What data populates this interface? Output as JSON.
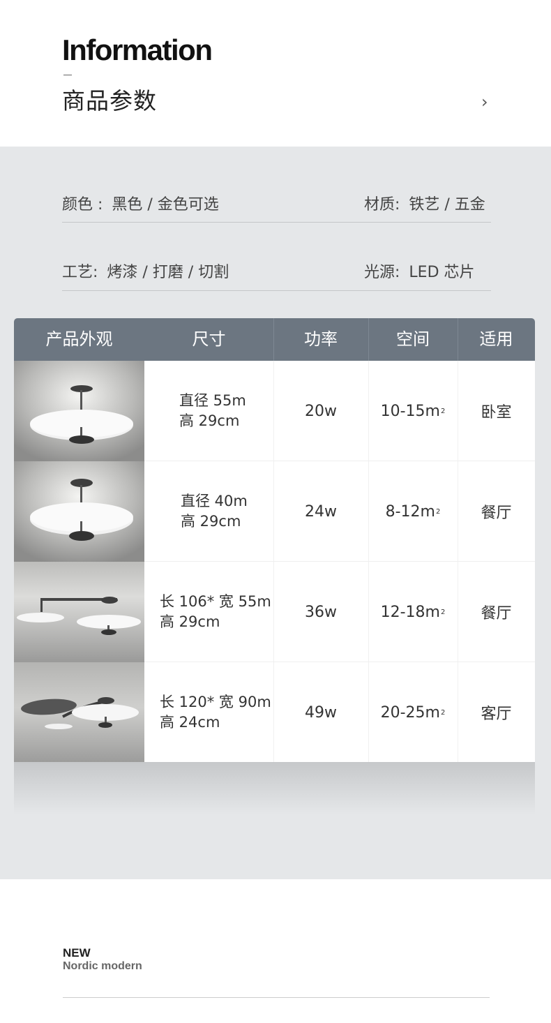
{
  "header": {
    "title_en": "Information",
    "title_cn": "商品参数"
  },
  "specs": [
    {
      "label": "颜色 : ",
      "value": "黑色 / 金色可选"
    },
    {
      "label": "材质: ",
      "value": "铁艺 / 五金"
    },
    {
      "label": "工艺: ",
      "value": "烤漆 / 打磨 / 切割"
    },
    {
      "label": "光源: ",
      "value": "LED 芯片"
    }
  ],
  "table": {
    "headers": [
      "产品外观",
      "尺寸",
      "功率",
      "空间",
      "适用"
    ],
    "rows": [
      {
        "size_line1": "直径 55m",
        "size_line2": "高 29cm",
        "power": "20w",
        "space": "10-15m",
        "space_sup": "2",
        "room": "卧室",
        "product_icon": "round-ceiling-lamp-image"
      },
      {
        "size_line1": "直径 40m",
        "size_line2": "高 29cm",
        "power": "24w",
        "space": "8-12m",
        "space_sup": "2",
        "room": "餐厅",
        "product_icon": "round-ceiling-lamp-image"
      },
      {
        "size_line1": "长 106* 宽 55m",
        "size_line2": "高 29cm",
        "power": "36w",
        "space": "12-18m",
        "space_sup": "2",
        "room": "餐厅",
        "product_icon": "double-disc-lamp-image"
      },
      {
        "size_line1": "长 120* 宽 90m",
        "size_line2": "高 24cm",
        "power": "49w",
        "space": "20-25m",
        "space_sup": "2",
        "room": "客厅",
        "product_icon": "triple-disc-lamp-image"
      }
    ]
  },
  "footer": {
    "new": "NEW",
    "tagline": "Nordic modern"
  },
  "colors": {
    "header_bg": "#6c7681",
    "section_bg": "#e5e7e9"
  }
}
